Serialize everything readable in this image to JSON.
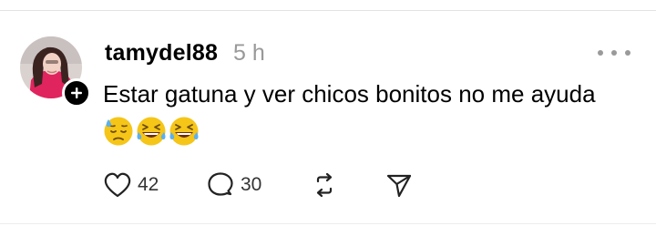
{
  "post": {
    "author": {
      "username": "tamydel88",
      "avatar_icon": "user-avatar-photo",
      "follow_icon": "plus-icon"
    },
    "timestamp": "5 h",
    "more_icon": "more-horizontal-icon",
    "text": "Estar gatuna y ver chicos bonitos no me ayuda",
    "emojis": [
      "downcast-face-with-sweat",
      "grinning-squinting-face-with-sweat",
      "grinning-squinting-face-with-sweat"
    ],
    "actions": {
      "like": {
        "icon": "heart-icon",
        "count": "42"
      },
      "reply": {
        "icon": "comment-bubble-icon",
        "count": "30"
      },
      "repost": {
        "icon": "repost-icon"
      },
      "share": {
        "icon": "send-icon"
      }
    }
  },
  "colors": {
    "background": "#ffffff",
    "text": "#000000",
    "secondary_text": "#999999",
    "divider": "#e3e3e3",
    "emoji_yellow": "#f5c518",
    "sweat_blue": "#5ab0f0"
  }
}
